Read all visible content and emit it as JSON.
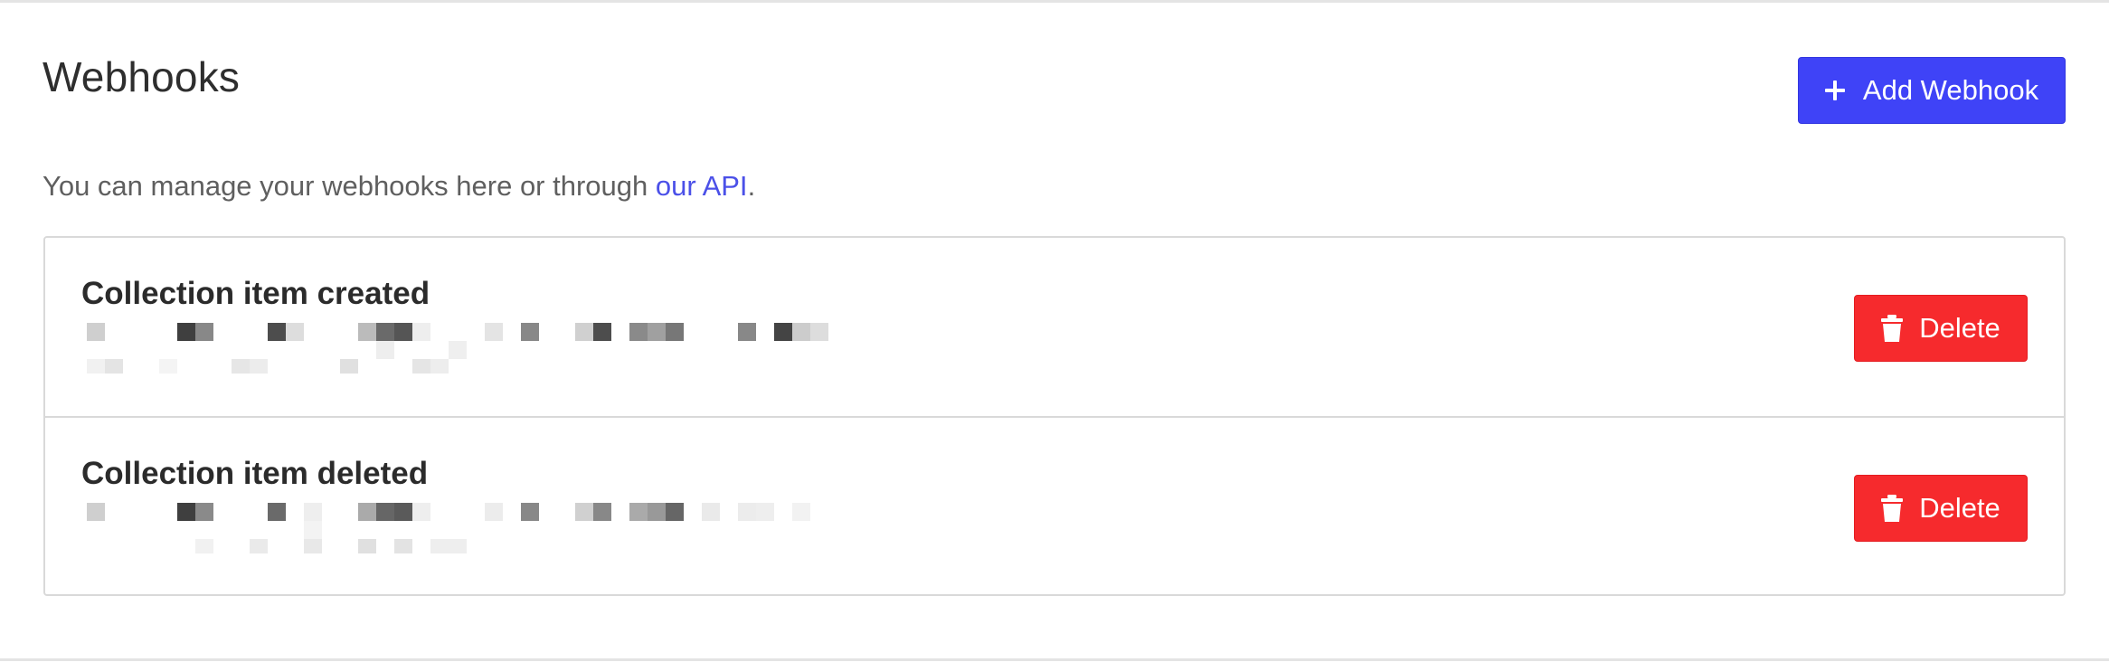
{
  "header": {
    "title": "Webhooks",
    "add_button_label": "Add Webhook"
  },
  "description": {
    "text": "You can manage your webhooks here or through ",
    "link_text": "our API",
    "suffix": "."
  },
  "webhooks": [
    {
      "event": "Collection item created",
      "delete_label": "Delete"
    },
    {
      "event": "Collection item deleted",
      "delete_label": "Delete"
    }
  ],
  "icons": {
    "add": "plus-icon",
    "delete": "trash-icon"
  },
  "colors": {
    "primary": "#3f43f7",
    "danger": "#f62a2d",
    "link": "#4b50e8",
    "border": "#d9d9d9"
  }
}
